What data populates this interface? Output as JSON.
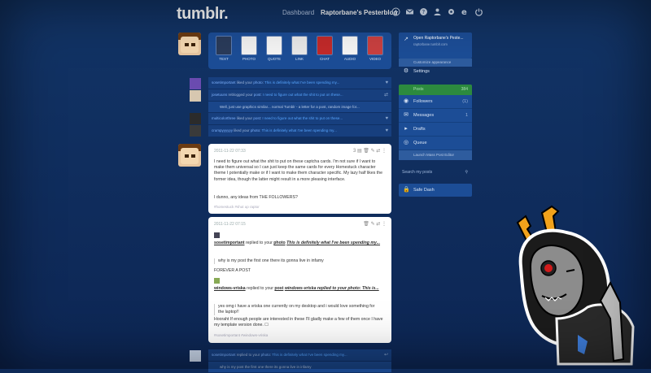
{
  "header": {
    "logo": "tumblr.",
    "dashboard_label": "Dashboard",
    "blog_label": "Raptorbane's Pesterblog"
  },
  "post_types": [
    {
      "label": "TEXT"
    },
    {
      "label": "PHOTO"
    },
    {
      "label": "QUOTE"
    },
    {
      "label": "LINK"
    },
    {
      "label": "CHAT"
    },
    {
      "label": "AUDIO"
    },
    {
      "label": "VIDEO"
    }
  ],
  "notifications_top": [
    {
      "user": "sosetimportant",
      "action": "liked your",
      "kind": "photo",
      "quote": "This is definitely what I've been spending my..."
    },
    {
      "user": "josetuuns",
      "action": "reblogged your",
      "kind": "post",
      "quote": "I need to figure out what the shit to put on these..."
    },
    {
      "user": "multicolorthree",
      "action": "liked your",
      "kind": "post",
      "quote": "I need to figure out what the shit to put on these..."
    },
    {
      "user": "crumpyyyyyy",
      "action": "liked your",
      "kind": "photo",
      "quote": "This is definitely what I've been spending my..."
    }
  ],
  "reblog_reply": "Well, just use graphics similar... normal Tumblr - a letter for a post, random image for...",
  "post1": {
    "date": "2011-11-22 07:33",
    "count": "3",
    "body": "I need to figure out what the shit to put on these captcha cards. I'm not sure if I want to make them universal so I can just keep the same cards for every Homestuck character theme I potentially make or if I want to make them character specific. My lazy half likes the former idea, though the latter might result in a more pleasing interface.",
    "body2": "I dunno, any ideas from THE FOLLOWERS?",
    "tags": "#homestuck  #shut up raptor"
  },
  "post2": {
    "date": "2011-11-22 07:15",
    "user1": "sosetimportant",
    "replied": "replied to your",
    "kind1": "photo",
    "quote1": "This is definitely what I've been spending my...",
    "reply1": "why is my post the first one there its gonna live in infamy",
    "response1": "FOREVER A POST",
    "user2": "windows-vriska",
    "kind2": "post",
    "quote2": "windows-vriska replied to your photo: This is...",
    "reply2": "yes omg i have a vriska one currently on my desktop and i would love something for the laptop!!",
    "response2": "Hooraht If enough people are interested in these I'll gladly make a few of them once I have my template version done. ☐",
    "tags": "#sosetimportant  #windows-vriska"
  },
  "notifications_bottom": {
    "user": "sosetimportant",
    "action": "replied to your",
    "kind": "photo",
    "quote": "This is definitely what I've been spending my...",
    "reply": "why is my post the first one there its gonna live in infamy"
  },
  "sidebar": {
    "open_label": "Open Raptorbane's Peste...",
    "open_sub": "raptorbane.tumblr.com",
    "customize": "Customize appearance",
    "settings": "Settings",
    "posts": "Posts",
    "posts_count": "384",
    "followers": "Followers",
    "followers_count": "(1)",
    "messages": "Messages",
    "messages_count": "1",
    "drafts": "Drafts",
    "queue": "Queue",
    "launch": "Launch Mass Post Editor",
    "search_placeholder": "Search my posts",
    "safe": "Safe Dash"
  },
  "colors": {
    "accent": "#1c4d96",
    "green": "#2c8a3e",
    "link": "#58a6ff"
  }
}
